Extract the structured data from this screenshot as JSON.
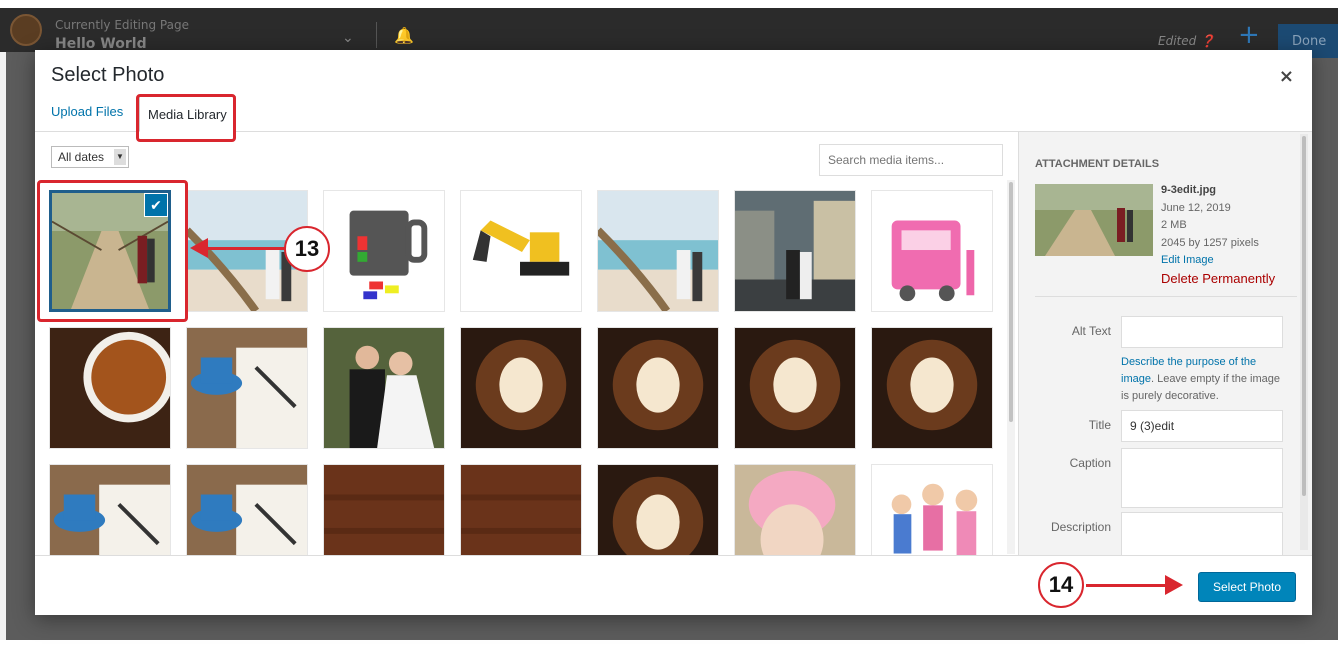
{
  "background": {
    "editing_label": "Currently Editing Page",
    "editing_page": "Hello World",
    "edited_label": "Edited ❓",
    "done_label": "Done"
  },
  "modal": {
    "title": "Select Photo",
    "close_icon": "×",
    "tabs": {
      "upload": "Upload Files",
      "library": "Media Library"
    },
    "filter": {
      "dates_value": "All dates",
      "dates_arrow": "▼"
    },
    "search": {
      "placeholder": "Search media items..."
    },
    "checkmark": "✔",
    "sidebar": {
      "heading": "ATTACHMENT DETAILS",
      "filename": "9-3edit.jpg",
      "date": "June 12, 2019",
      "size": "2 MB",
      "dimensions": "2045 by 1257 pixels",
      "edit_link": "Edit Image",
      "delete_link": "Delete Permanently",
      "alt_text_label": "Alt Text",
      "alt_text_value": "",
      "help_link": "Describe the purpose of the image",
      "help_rest": ". Leave empty if the image is purely decorative.",
      "title_label": "Title",
      "title_value": "9 (3)edit",
      "caption_label": "Caption",
      "caption_value": "",
      "description_label": "Description",
      "description_value": ""
    },
    "select_button": "Select Photo"
  },
  "annotations": {
    "step_13": "13",
    "step_14": "14",
    "color": "#d9262e"
  },
  "media_items": [
    "bridge-couple",
    "beach-couple",
    "lego-mug",
    "toy-excavator",
    "beach-couple",
    "city-couple",
    "barbie-camper",
    "coffee-beans-cup",
    "coffee-notebook",
    "wedding-couple",
    "latte-art",
    "latte-art",
    "latte-art",
    "latte-art",
    "coffee-notebook",
    "coffee-notebook",
    "wood-coffee",
    "wood-coffee",
    "latte-art",
    "baby-helmet",
    "kids-group"
  ]
}
